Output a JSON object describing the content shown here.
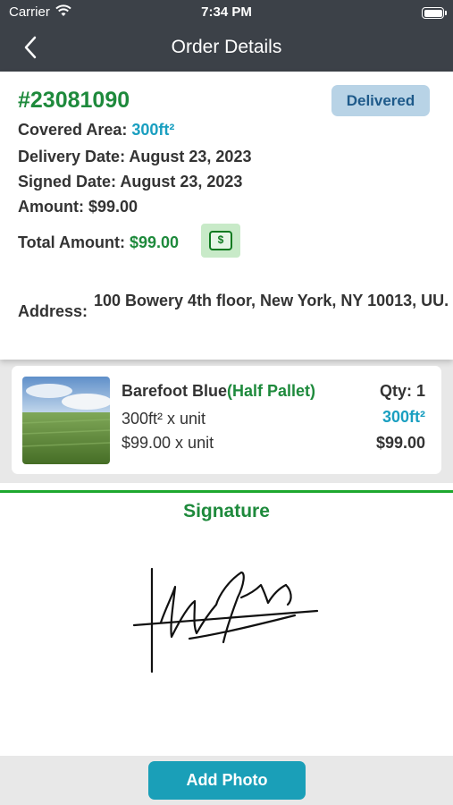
{
  "status_bar": {
    "carrier": "Carrier",
    "time": "7:34 PM"
  },
  "nav": {
    "title": "Order Details"
  },
  "order": {
    "number": "#23081090",
    "status": "Delivered",
    "covered_area_label": "Covered Area: ",
    "covered_area_value": "300ft²",
    "delivery_date_label": "Delivery Date: ",
    "delivery_date_value": "August 23, 2023",
    "signed_date_label": "Signed Date: ",
    "signed_date_value": "August 23, 2023",
    "amount_label": "Amount: ",
    "amount_value": "$99.00",
    "total_label": "Total Amount: ",
    "total_value": "$99.00",
    "address_label": "Address:",
    "address_value": "100 Bowery 4th floor, New York, NY 10013, UU.",
    "money_icon_symbol": "$"
  },
  "product": {
    "name": "Barefoot Blue",
    "variant": "(Half Pallet)",
    "qty": "Qty: 1",
    "area_per_unit": "300ft² x unit",
    "area_total": "300ft²",
    "price_per_unit": "$99.00 x unit",
    "price_total": "$99.00"
  },
  "signature": {
    "title": "Signature"
  },
  "actions": {
    "add_photo": "Add Photo"
  },
  "colors": {
    "header": "#3c4148",
    "green": "#1e8a3c",
    "blue": "#1a9fc0",
    "badge_bg": "#b8d3e6",
    "button": "#1a9fb8"
  },
  "icons": {
    "back": "chevron-left-icon",
    "wifi": "wifi-icon",
    "battery": "battery-icon",
    "money": "money-bill-icon"
  }
}
